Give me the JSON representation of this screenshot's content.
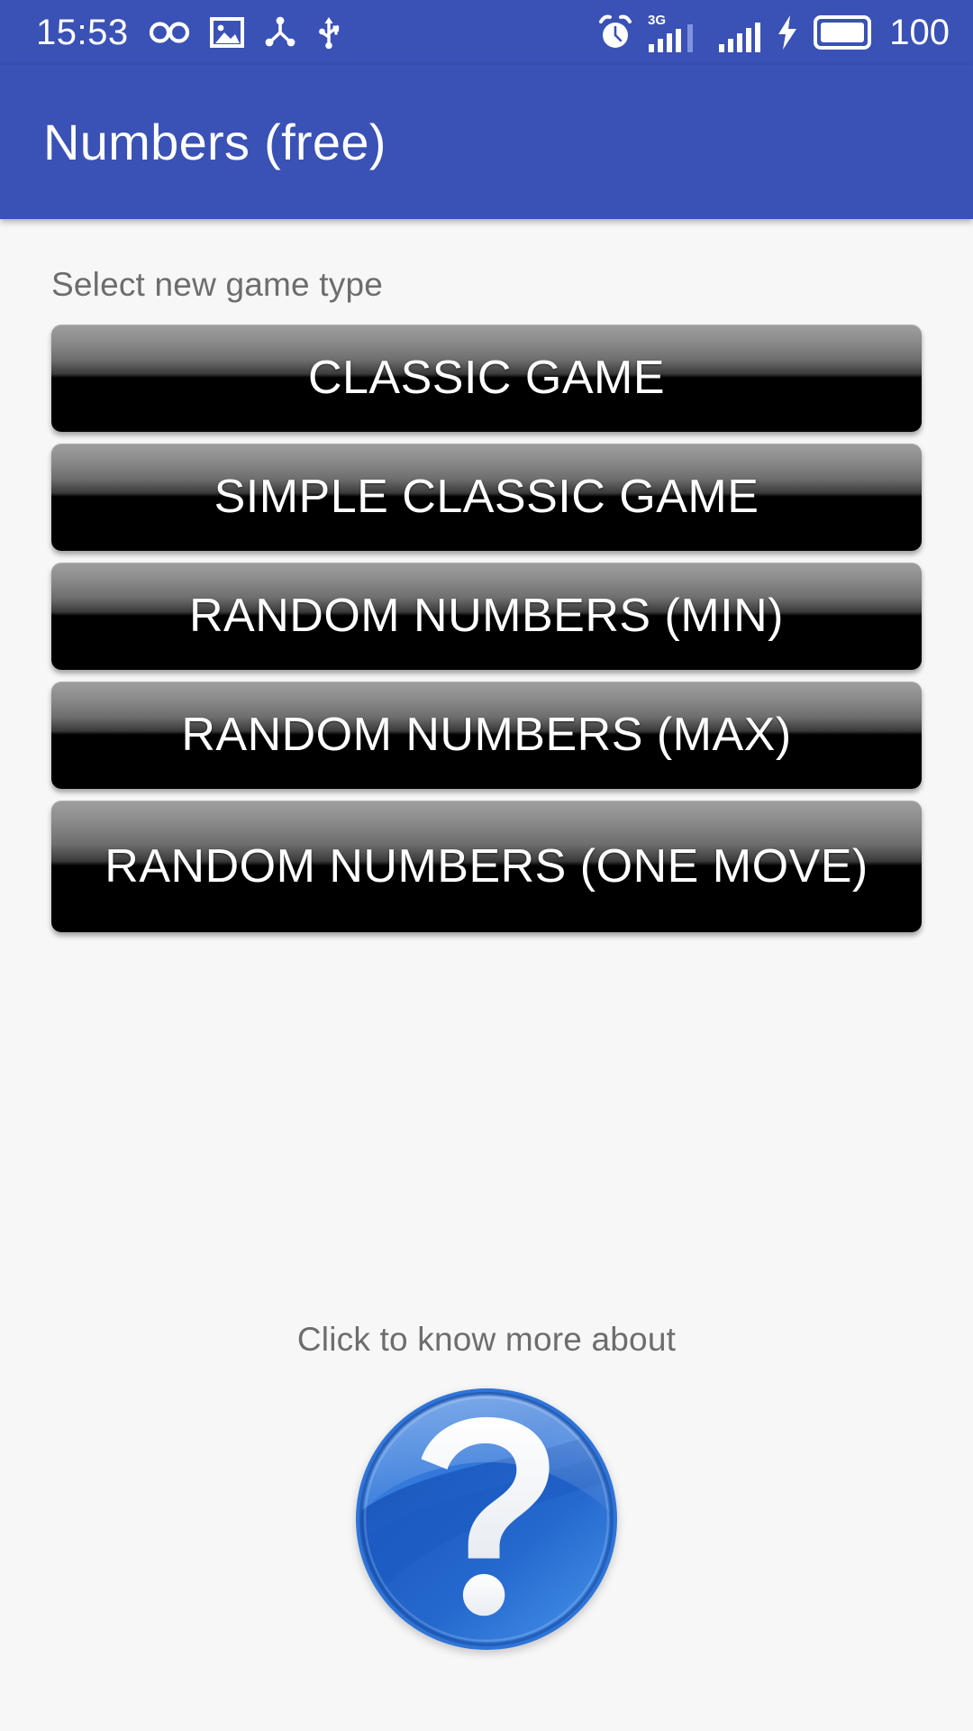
{
  "statusbar": {
    "time": "15:53",
    "battery_percent": "100",
    "network_label": "3G",
    "left_icons": [
      {
        "name": "infinity-icon",
        "label": "infinity"
      },
      {
        "name": "photo-icon",
        "label": "image"
      },
      {
        "name": "share-nodes-icon",
        "label": "share"
      },
      {
        "name": "usb-icon",
        "label": "usb"
      }
    ],
    "right_icons": [
      {
        "name": "alarm-clock-icon",
        "label": "alarm"
      },
      {
        "name": "signal-bars-3g-icon",
        "label": "3G signal"
      },
      {
        "name": "signal-bars-icon",
        "label": "signal"
      },
      {
        "name": "charging-bolt-icon",
        "label": "charging"
      },
      {
        "name": "battery-full-icon",
        "label": "battery"
      }
    ]
  },
  "appbar": {
    "title": "Numbers (free)",
    "background_color": "#3a51b5",
    "title_color": "#ffffff"
  },
  "main": {
    "section_label": "Select new game type",
    "buttons": [
      {
        "label": "CLASSIC GAME",
        "lines": 1
      },
      {
        "label": "SIMPLE CLASSIC GAME",
        "lines": 1
      },
      {
        "label": "RANDOM NUMBERS (MIN)",
        "lines": 1
      },
      {
        "label": "RANDOM NUMBERS (MAX)",
        "lines": 1
      },
      {
        "label": "RANDOM NUMBERS (ONE MOVE)",
        "lines": 2
      }
    ]
  },
  "footer": {
    "help_text": "Click to know more about",
    "help_icon_name": "question-mark-circle-icon",
    "help_icon_colors": {
      "blue_dark": "#1f5fc4",
      "blue_mid": "#2f74d8",
      "blue_light": "#4f93e9",
      "mark": "#f2f4f7"
    }
  },
  "colors": {
    "page_background": "#f7f7f8",
    "accent": "#3a51b5",
    "muted_text": "#6d6d6d",
    "button_text": "#ffffff"
  }
}
